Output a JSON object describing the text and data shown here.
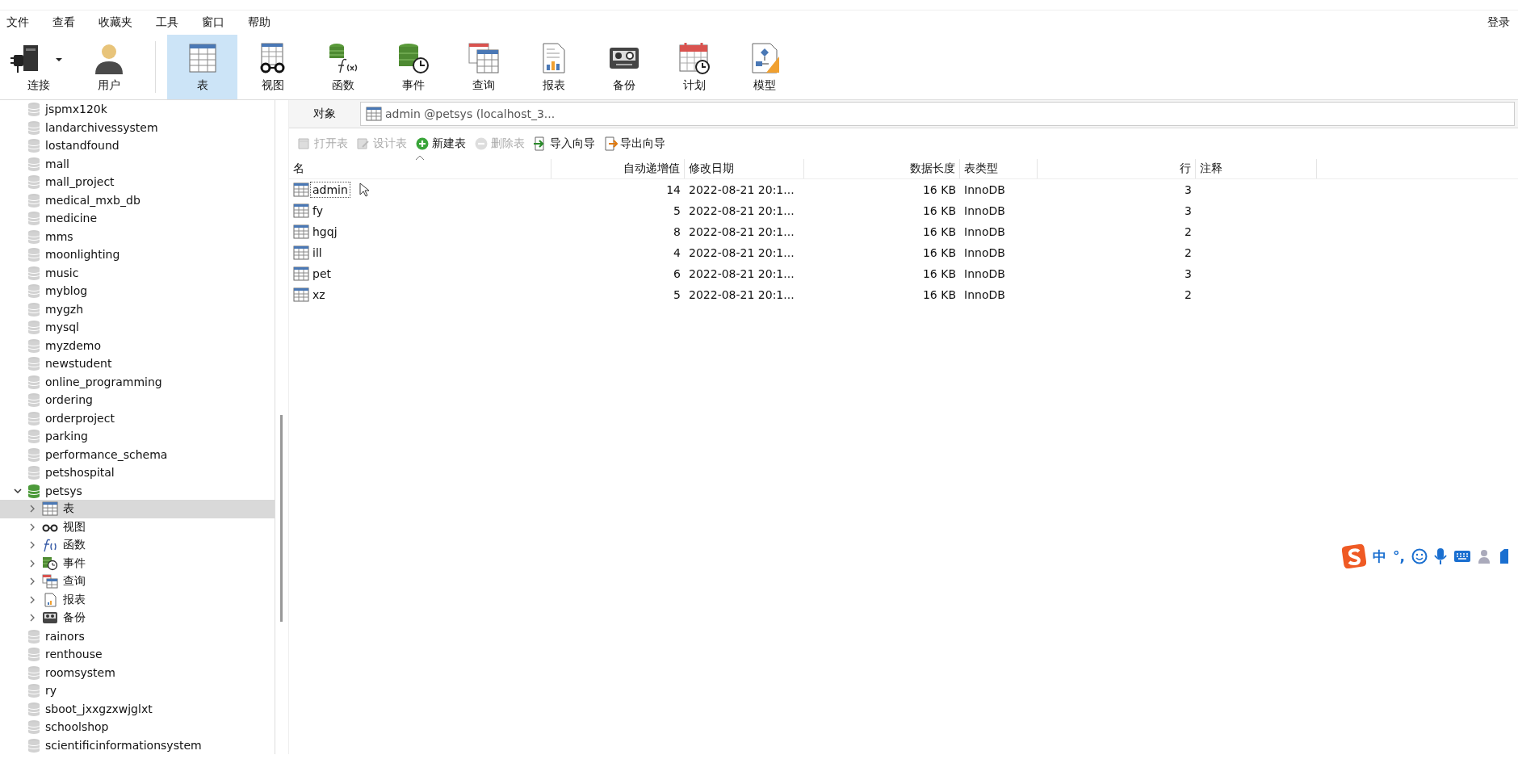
{
  "menu": [
    "文件",
    "查看",
    "收藏夹",
    "工具",
    "窗口",
    "帮助"
  ],
  "login": "登录",
  "toolbar": [
    {
      "label": "连接",
      "kind": "connect",
      "selected": false
    },
    {
      "label": "用户",
      "kind": "user",
      "selected": false
    },
    {
      "label": "表",
      "kind": "table",
      "selected": true
    },
    {
      "label": "视图",
      "kind": "view",
      "selected": false
    },
    {
      "label": "函数",
      "kind": "function",
      "selected": false
    },
    {
      "label": "事件",
      "kind": "event",
      "selected": false
    },
    {
      "label": "查询",
      "kind": "query",
      "selected": false
    },
    {
      "label": "报表",
      "kind": "report",
      "selected": false
    },
    {
      "label": "备份",
      "kind": "backup",
      "selected": false
    },
    {
      "label": "计划",
      "kind": "schedule",
      "selected": false
    },
    {
      "label": "模型",
      "kind": "model",
      "selected": false
    }
  ],
  "sidebar": {
    "items": [
      {
        "name": "jspmx120k",
        "expanded": false
      },
      {
        "name": "landarchivessystem",
        "expanded": false
      },
      {
        "name": "lostandfound",
        "expanded": false
      },
      {
        "name": "mall",
        "expanded": false
      },
      {
        "name": "mall_project",
        "expanded": false
      },
      {
        "name": "medical_mxb_db",
        "expanded": false
      },
      {
        "name": "medicine",
        "expanded": false
      },
      {
        "name": "mms",
        "expanded": false
      },
      {
        "name": "moonlighting",
        "expanded": false
      },
      {
        "name": "music",
        "expanded": false
      },
      {
        "name": "myblog",
        "expanded": false
      },
      {
        "name": "mygzh",
        "expanded": false
      },
      {
        "name": "mysql",
        "expanded": false
      },
      {
        "name": "myzdemo",
        "expanded": false
      },
      {
        "name": "newstudent",
        "expanded": false
      },
      {
        "name": "online_programming",
        "expanded": false
      },
      {
        "name": "ordering",
        "expanded": false
      },
      {
        "name": "orderproject",
        "expanded": false
      },
      {
        "name": "parking",
        "expanded": false
      },
      {
        "name": "performance_schema",
        "expanded": false
      },
      {
        "name": "petshospital",
        "expanded": false
      },
      {
        "name": "petsys",
        "expanded": true,
        "children": [
          {
            "name": "表",
            "kind": "table",
            "expanded": false,
            "selected": true
          },
          {
            "name": "视图",
            "kind": "view",
            "expanded": false,
            "selected": false
          },
          {
            "name": "函数",
            "kind": "function",
            "expanded": false,
            "selected": false
          },
          {
            "name": "事件",
            "kind": "event",
            "expanded": false,
            "selected": false
          },
          {
            "name": "查询",
            "kind": "query",
            "expanded": false,
            "selected": false
          },
          {
            "name": "报表",
            "kind": "report",
            "expanded": false,
            "selected": false
          },
          {
            "name": "备份",
            "kind": "backup",
            "expanded": false,
            "selected": false
          }
        ]
      },
      {
        "name": "rainors",
        "expanded": false
      },
      {
        "name": "renthouse",
        "expanded": false
      },
      {
        "name": "roomsystem",
        "expanded": false
      },
      {
        "name": "ry",
        "expanded": false
      },
      {
        "name": "sboot_jxxgzxwjglxt",
        "expanded": false
      },
      {
        "name": "schoolshop",
        "expanded": false
      },
      {
        "name": "scientificinformationsystem",
        "expanded": false
      }
    ]
  },
  "object_bar": {
    "label": "对象",
    "tab": "admin @petsys (localhost_3..."
  },
  "object_toolbar": [
    {
      "label": "打开表",
      "kind": "open",
      "disabled": true
    },
    {
      "label": "设计表",
      "kind": "design",
      "disabled": true
    },
    {
      "label": "新建表",
      "kind": "new",
      "disabled": false
    },
    {
      "label": "删除表",
      "kind": "delete",
      "disabled": true
    },
    {
      "label": "导入向导",
      "kind": "import",
      "disabled": false
    },
    {
      "label": "导出向导",
      "kind": "export",
      "disabled": false
    }
  ],
  "table": {
    "columns": [
      "名",
      "自动递增值",
      "修改日期",
      "数据长度",
      "表类型",
      "行",
      "注释"
    ],
    "rows": [
      {
        "selected": true,
        "cells": [
          "admin",
          "14",
          "2022-08-21 20:1...",
          "16 KB",
          "InnoDB",
          "3"
        ]
      },
      {
        "selected": false,
        "cells": [
          "fy",
          "5",
          "2022-08-21 20:1...",
          "16 KB",
          "InnoDB",
          "3"
        ]
      },
      {
        "selected": false,
        "cells": [
          "hgqj",
          "8",
          "2022-08-21 20:1...",
          "16 KB",
          "InnoDB",
          "2"
        ]
      },
      {
        "selected": false,
        "cells": [
          "ill",
          "4",
          "2022-08-21 20:1...",
          "16 KB",
          "InnoDB",
          "2"
        ]
      },
      {
        "selected": false,
        "cells": [
          "pet",
          "6",
          "2022-08-21 20:1...",
          "16 KB",
          "InnoDB",
          "3"
        ]
      },
      {
        "selected": false,
        "cells": [
          "xz",
          "5",
          "2022-08-21 20:1...",
          "16 KB",
          "InnoDB",
          "2"
        ]
      }
    ]
  },
  "ime_bar": {
    "mode": "中",
    "punctuation": "°,"
  }
}
